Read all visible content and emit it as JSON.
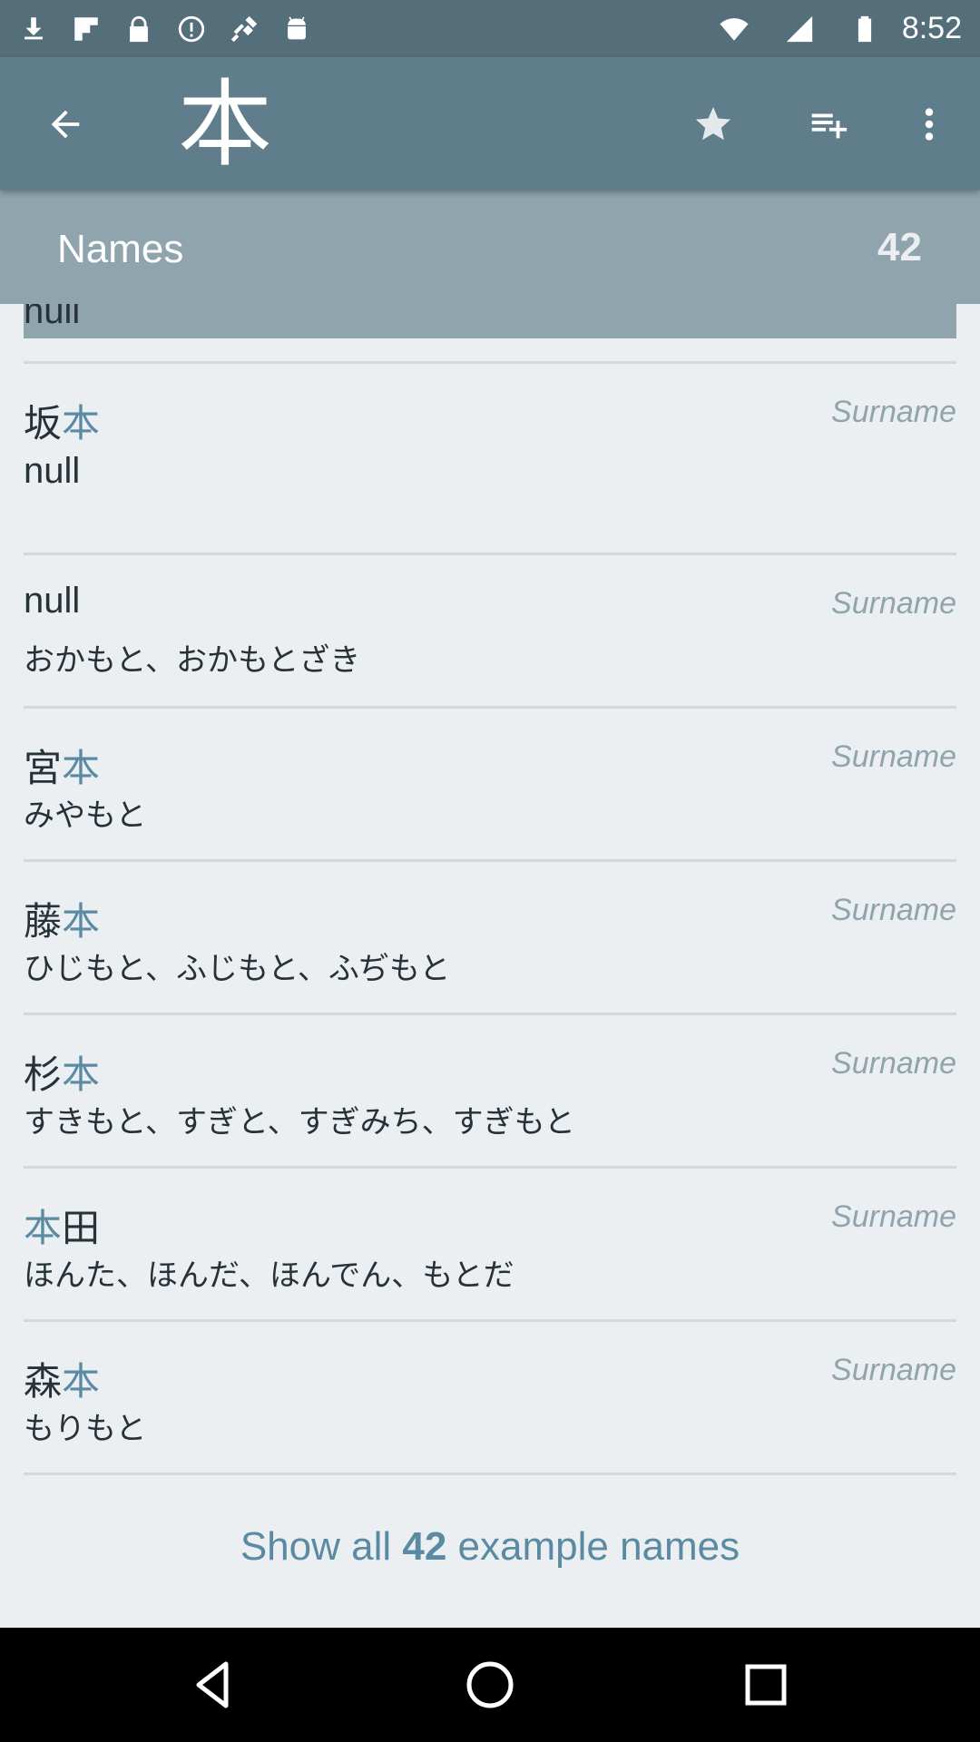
{
  "status_bar": {
    "time": "8:52",
    "icons": [
      "download-icon",
      "flipboard-icon",
      "lock-icon",
      "alert-icon",
      "fake-gps-icon",
      "android-icon",
      "wifi-icon",
      "signal-icon",
      "battery-icon"
    ]
  },
  "app_bar": {
    "title_kanji": "本",
    "actions": [
      "star-icon",
      "add-to-list-icon",
      "more-vert-icon"
    ]
  },
  "section": {
    "title": "Names",
    "count": "42"
  },
  "partial_row": {
    "text": "null"
  },
  "rows": [
    {
      "name_pre": "坂",
      "name_hl": "本",
      "name_post": "",
      "reading": "null",
      "type": "Surname"
    },
    {
      "name_pre": "null",
      "name_hl": "",
      "name_post": "",
      "reading": "おかもと、おかもとざき",
      "type": "Surname"
    },
    {
      "name_pre": "宮",
      "name_hl": "本",
      "name_post": "",
      "reading": "みやもと",
      "type": "Surname"
    },
    {
      "name_pre": "藤",
      "name_hl": "本",
      "name_post": "",
      "reading": "ひじもと、ふじもと、ふぢもと",
      "type": "Surname"
    },
    {
      "name_pre": "杉",
      "name_hl": "本",
      "name_post": "",
      "reading": "すきもと、すぎと、すぎみち、すぎもと",
      "type": "Surname"
    },
    {
      "name_pre": "",
      "name_hl": "本",
      "name_post": "田",
      "reading": "ほんた、ほんだ、ほんでん、もとだ",
      "type": "Surname"
    },
    {
      "name_pre": "森",
      "name_hl": "本",
      "name_post": "",
      "reading": "もりもと",
      "type": "Surname"
    }
  ],
  "show_all": {
    "prefix": "Show all ",
    "count": "42",
    "suffix": " example names"
  },
  "colors": {
    "app_bar": "#607d8b",
    "status_bar": "#546e7a",
    "section_header": "#90a4ae",
    "accent": "#5b8aa3",
    "background": "#eceff1"
  }
}
